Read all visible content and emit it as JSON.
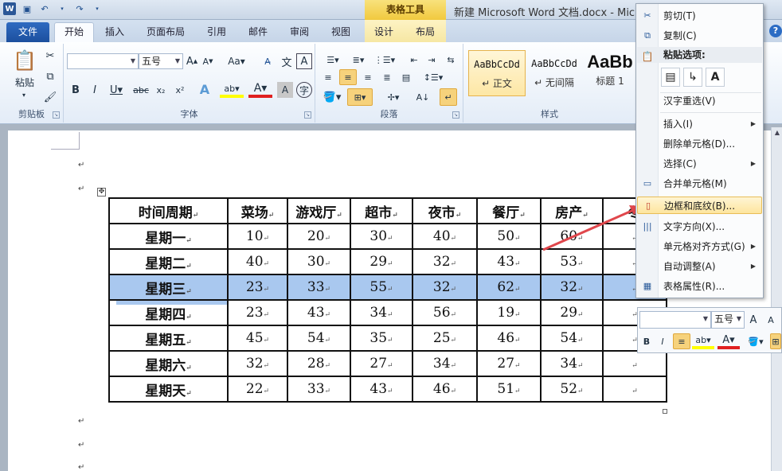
{
  "window": {
    "title": "新建 Microsoft Word 文档.docx  -  Micro",
    "contextual_group": "表格工具"
  },
  "tabs": {
    "file": "文件",
    "items": [
      {
        "label": "开始",
        "active": true
      },
      {
        "label": "插入"
      },
      {
        "label": "页面布局"
      },
      {
        "label": "引用"
      },
      {
        "label": "邮件"
      },
      {
        "label": "审阅"
      },
      {
        "label": "视图"
      },
      {
        "label": "设计"
      },
      {
        "label": "布局"
      }
    ]
  },
  "ribbon": {
    "clipboard": {
      "paste": "粘贴",
      "label": "剪贴板"
    },
    "font": {
      "font_size": "五号",
      "label": "字体"
    },
    "paragraph": {
      "label": "段落"
    },
    "styles": {
      "label": "样式",
      "items": [
        {
          "sample": "AaBbCcDd",
          "name": "↵ 正文"
        },
        {
          "sample": "AaBbCcDd",
          "name": "↵ 无间隔"
        },
        {
          "sample": "AaBb",
          "name": "标题 1"
        }
      ]
    }
  },
  "table": {
    "headers": [
      "时间周期",
      "菜场",
      "游戏厅",
      "超市",
      "夜市",
      "餐厅",
      "房产",
      "冬"
    ],
    "rows": [
      {
        "label": "星期一",
        "values": [
          "10",
          "20",
          "30",
          "40",
          "50",
          "60",
          ""
        ]
      },
      {
        "label": "星期二",
        "values": [
          "40",
          "30",
          "29",
          "32",
          "43",
          "53",
          ""
        ]
      },
      {
        "label": "星期三",
        "values": [
          "23",
          "33",
          "55",
          "32",
          "62",
          "32",
          ""
        ]
      },
      {
        "label": "星期四",
        "values": [
          "23",
          "43",
          "34",
          "56",
          "19",
          "29",
          ""
        ]
      },
      {
        "label": "星期五",
        "values": [
          "45",
          "54",
          "35",
          "25",
          "46",
          "54",
          ""
        ]
      },
      {
        "label": "星期六",
        "values": [
          "32",
          "28",
          "27",
          "34",
          "27",
          "34",
          ""
        ]
      },
      {
        "label": "星期天",
        "values": [
          "22",
          "33",
          "43",
          "46",
          "51",
          "52",
          ""
        ]
      }
    ],
    "selected_row": 2
  },
  "context_menu": {
    "cut": "剪切(T)",
    "copy": "复制(C)",
    "paste_options": "粘贴选项:",
    "reconvert": "汉字重选(V)",
    "insert": "插入(I)",
    "delete_cells": "删除单元格(D)...",
    "select": "选择(C)",
    "merge_cells": "合并单元格(M)",
    "borders_shading": "边框和底纹(B)...",
    "text_direction": "文字方向(X)...",
    "cell_alignment": "单元格对齐方式(G)",
    "autofit": "自动调整(A)",
    "table_properties": "表格属性(R)..."
  },
  "mini_toolbar": {
    "font_size": "五号"
  },
  "colors": {
    "accent": "#2b5797",
    "highlight": "#a9c8ef",
    "hover": "#fde59e",
    "annotation_arrow": "#e0474c"
  }
}
